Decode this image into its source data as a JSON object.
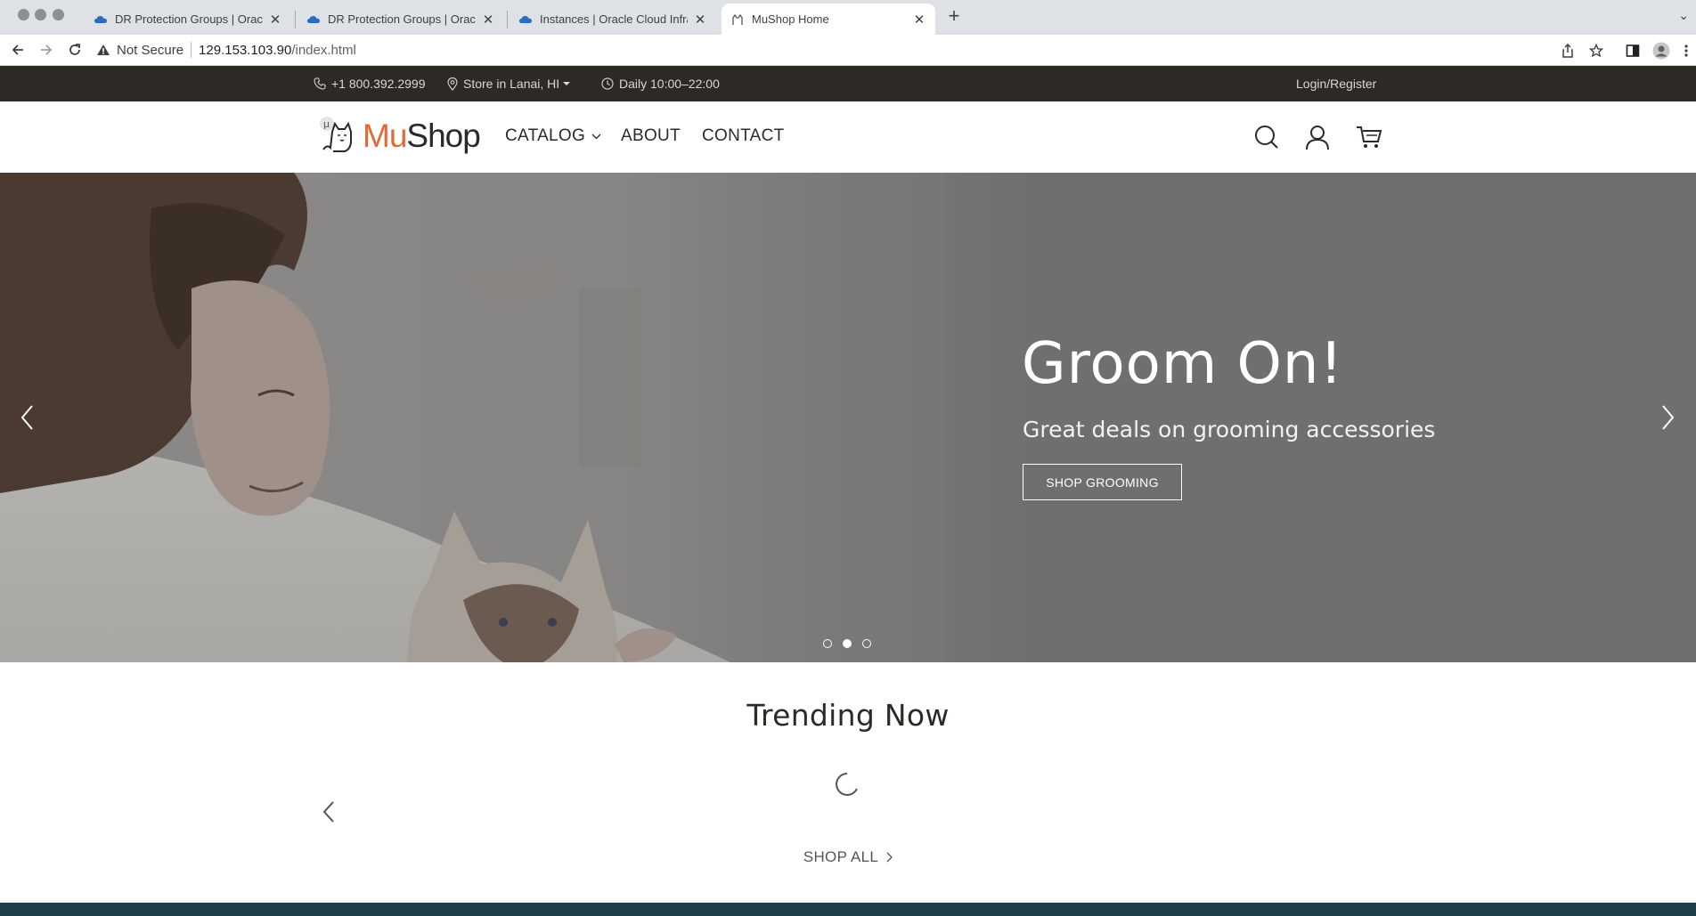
{
  "browser": {
    "tabs": [
      {
        "title": "DR Protection Groups | Oracle Cloud Infrastructure",
        "favicon": "oracle-cloud-icon",
        "active": false
      },
      {
        "title": "DR Protection Groups | Oracle Cloud Infrastructure",
        "favicon": "oracle-cloud-icon",
        "active": false
      },
      {
        "title": "Instances | Oracle Cloud Infrastructure",
        "favicon": "oracle-cloud-icon",
        "active": false
      },
      {
        "title": "MuShop Home",
        "favicon": "mushop-icon",
        "active": true
      }
    ],
    "security_label": "Not Secure",
    "url_host": "129.153.103.90",
    "url_path": "/index.html"
  },
  "topbar": {
    "phone": "+1 800.392.2999",
    "store": "Store in Lanai, HI",
    "hours": "Daily 10:00–22:00",
    "login": "Login/Register"
  },
  "header": {
    "logo_mu": "Mu",
    "logo_shop": "Shop",
    "nav": {
      "catalog": "CATALOG",
      "about": "ABOUT",
      "contact": "CONTACT"
    }
  },
  "hero": {
    "title": "Groom On!",
    "subtitle": "Great deals on grooming accessories",
    "button": "SHOP GROOMING",
    "slide_count": 3,
    "active_slide": 2
  },
  "trending": {
    "title": "Trending Now",
    "shop_all": "SHOP ALL"
  },
  "colors": {
    "topbar_bg": "#2d2a26",
    "accent_orange": "#e06b3a",
    "hero_overlay": "#6f6f6f",
    "footer_band": "#1d3f4a"
  }
}
